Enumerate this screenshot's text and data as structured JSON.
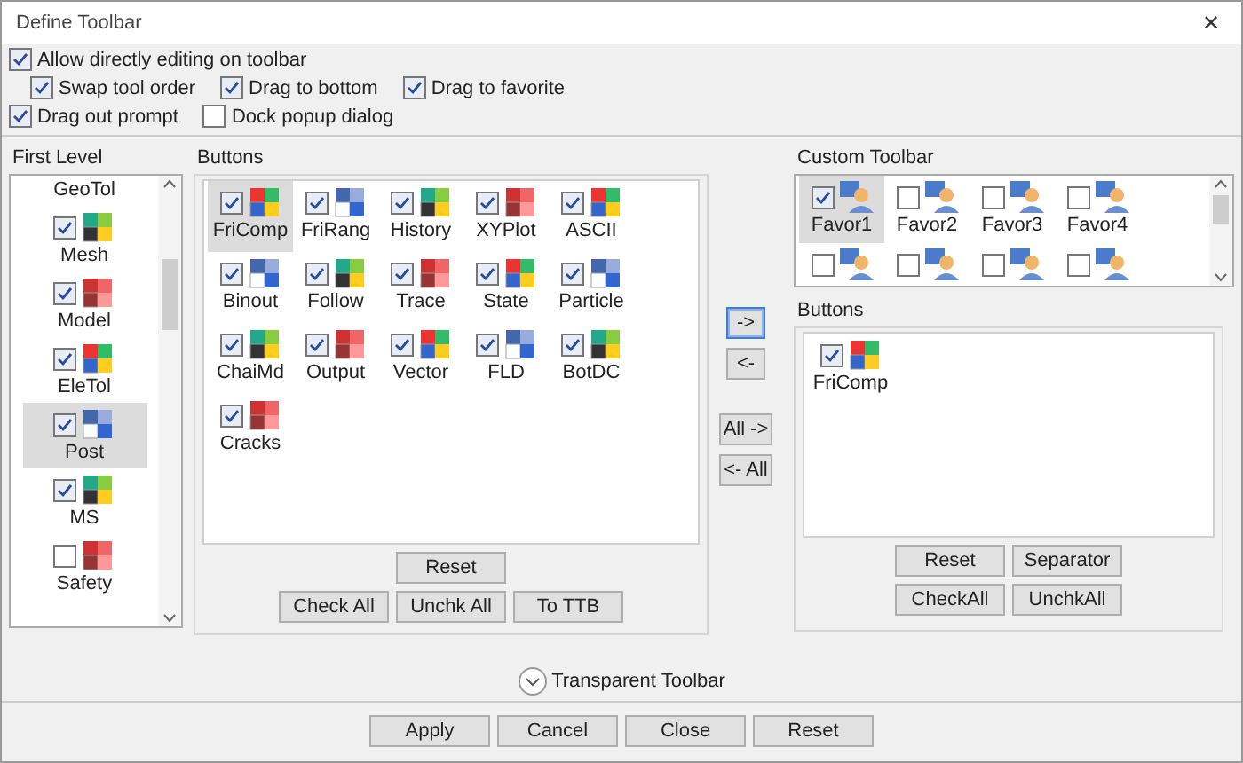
{
  "window": {
    "title": "Define Toolbar",
    "close": "✕"
  },
  "options": [
    [
      {
        "label": "Allow directly editing on toolbar",
        "checked": true
      }
    ],
    [
      {
        "label": "Swap tool order",
        "checked": true
      },
      {
        "label": "Drag to bottom",
        "checked": true
      },
      {
        "label": "Drag to favorite",
        "checked": true
      }
    ],
    [
      {
        "label": "Drag out prompt",
        "checked": true
      },
      {
        "label": "Dock popup dialog",
        "checked": false
      }
    ]
  ],
  "first_level": {
    "title": "First Level",
    "items": [
      {
        "label": "GeoTol",
        "selected": false
      },
      {
        "label": "Mesh",
        "checked": true,
        "selected": false
      },
      {
        "label": "Model",
        "checked": true,
        "selected": false
      },
      {
        "label": "EleTol",
        "checked": true,
        "selected": false
      },
      {
        "label": "Post",
        "checked": true,
        "selected": true
      },
      {
        "label": "MS",
        "checked": true,
        "selected": false
      },
      {
        "label": "Safety",
        "checked": false,
        "selected": false
      }
    ]
  },
  "buttons_group": {
    "title": "Buttons",
    "items": [
      {
        "label": "FriComp",
        "checked": true,
        "selected": true
      },
      {
        "label": "FriRang",
        "checked": true,
        "selected": false
      },
      {
        "label": "History",
        "checked": true,
        "selected": false
      },
      {
        "label": "XYPlot",
        "checked": true,
        "selected": false
      },
      {
        "label": "ASCII",
        "checked": true,
        "selected": false
      },
      {
        "label": "Binout",
        "checked": true,
        "selected": false
      },
      {
        "label": "Follow",
        "checked": true,
        "selected": false
      },
      {
        "label": "Trace",
        "checked": true,
        "selected": false
      },
      {
        "label": "State",
        "checked": true,
        "selected": false
      },
      {
        "label": "Particle",
        "checked": true,
        "selected": false
      },
      {
        "label": "ChaiMd",
        "checked": true,
        "selected": false
      },
      {
        "label": "Output",
        "checked": true,
        "selected": false
      },
      {
        "label": "Vector",
        "checked": true,
        "selected": false
      },
      {
        "label": "FLD",
        "checked": true,
        "selected": false
      },
      {
        "label": "BotDC",
        "checked": true,
        "selected": false
      },
      {
        "label": "Cracks",
        "checked": true,
        "selected": false
      }
    ],
    "reset": "Reset",
    "actions": [
      "Check All",
      "Unchk All",
      "To TTB"
    ]
  },
  "transfer_buttons": [
    {
      "label": "->",
      "focused": true
    },
    {
      "label": "<-",
      "focused": false
    },
    {
      "label": "All ->",
      "focused": false
    },
    {
      "label": "<- All",
      "focused": false
    }
  ],
  "custom_toolbar": {
    "title": "Custom Toolbar",
    "items": [
      {
        "label": "Favor1",
        "checked": true,
        "selected": true
      },
      {
        "label": "Favor2",
        "checked": false,
        "selected": false
      },
      {
        "label": "Favor3",
        "checked": false,
        "selected": false
      },
      {
        "label": "Favor4",
        "checked": false,
        "selected": false
      },
      {
        "checked": false,
        "selected": false
      },
      {
        "checked": false,
        "selected": false
      },
      {
        "checked": false,
        "selected": false
      },
      {
        "checked": false,
        "selected": false
      }
    ]
  },
  "custom_buttons": {
    "title": "Buttons",
    "items": [
      {
        "label": "FriComp",
        "checked": true
      }
    ],
    "actions": [
      "Reset",
      "Separator",
      "CheckAll",
      "UnchkAll"
    ]
  },
  "transparent_toolbar": {
    "label": "Transparent Toolbar",
    "expanded": false
  },
  "footer": [
    "Apply",
    "Cancel",
    "Close",
    "Reset"
  ]
}
